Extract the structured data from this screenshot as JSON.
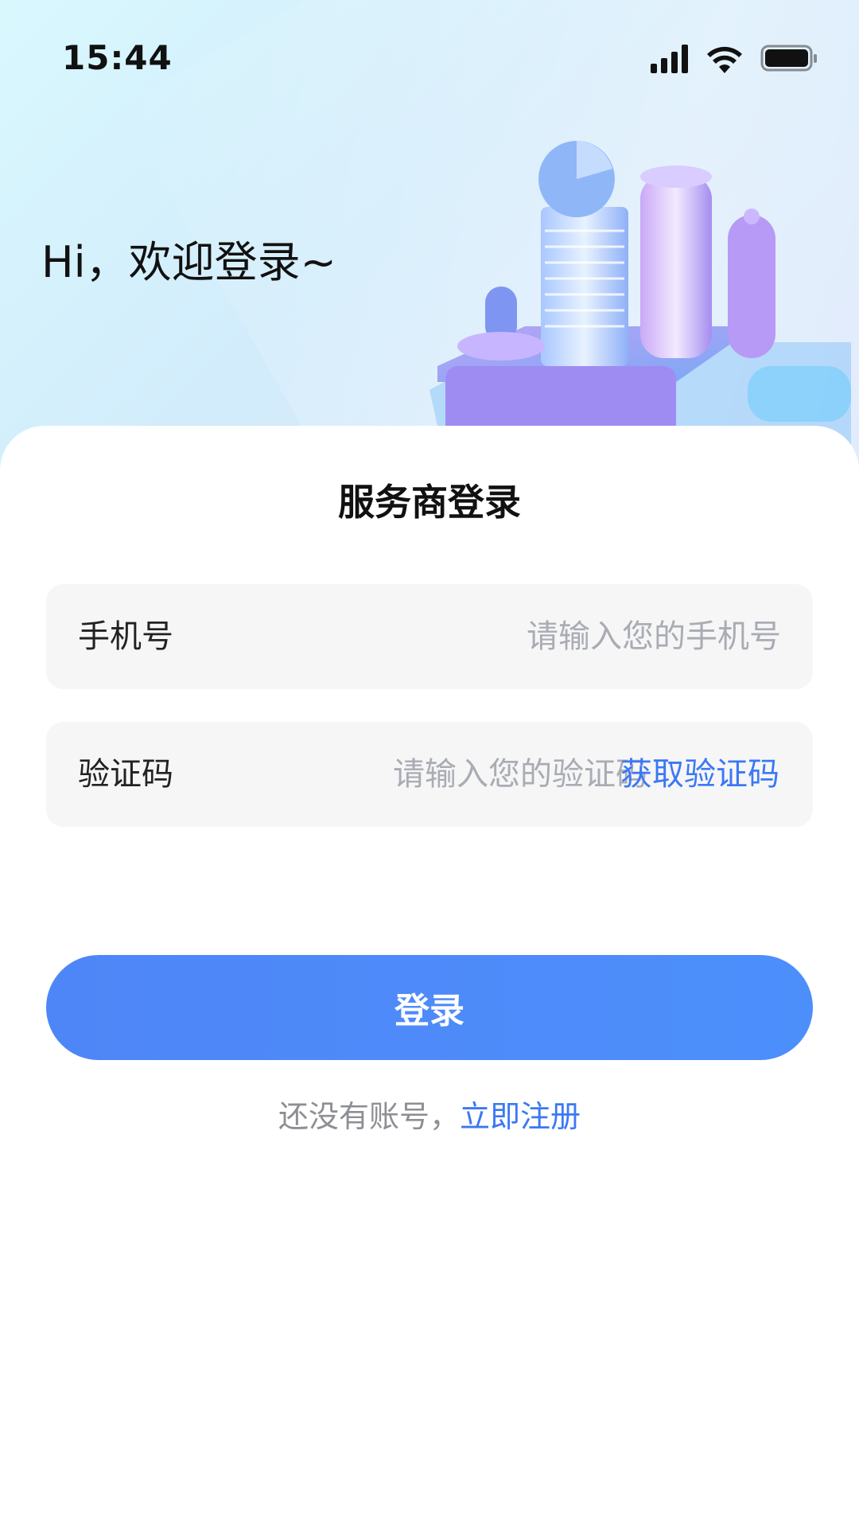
{
  "status_bar": {
    "time": "15:44"
  },
  "header": {
    "greeting": "Hi，欢迎登录~"
  },
  "form": {
    "title": "服务商登录",
    "phone_label": "手机号",
    "phone_placeholder": "请输入您的手机号",
    "phone_value": "",
    "code_label": "验证码",
    "code_placeholder": "请输入您的验证码",
    "code_value": "",
    "get_code_label": "获取验证码",
    "submit_label": "登录"
  },
  "register": {
    "prompt": "还没有账号，",
    "link_label": "立即注册"
  },
  "colors": {
    "accent": "#3b78f5",
    "button": "#4c8ffb",
    "field_bg": "#f6f6f7"
  },
  "icons": [
    "signal-icon",
    "wifi-icon",
    "battery-icon",
    "city-illustration"
  ]
}
